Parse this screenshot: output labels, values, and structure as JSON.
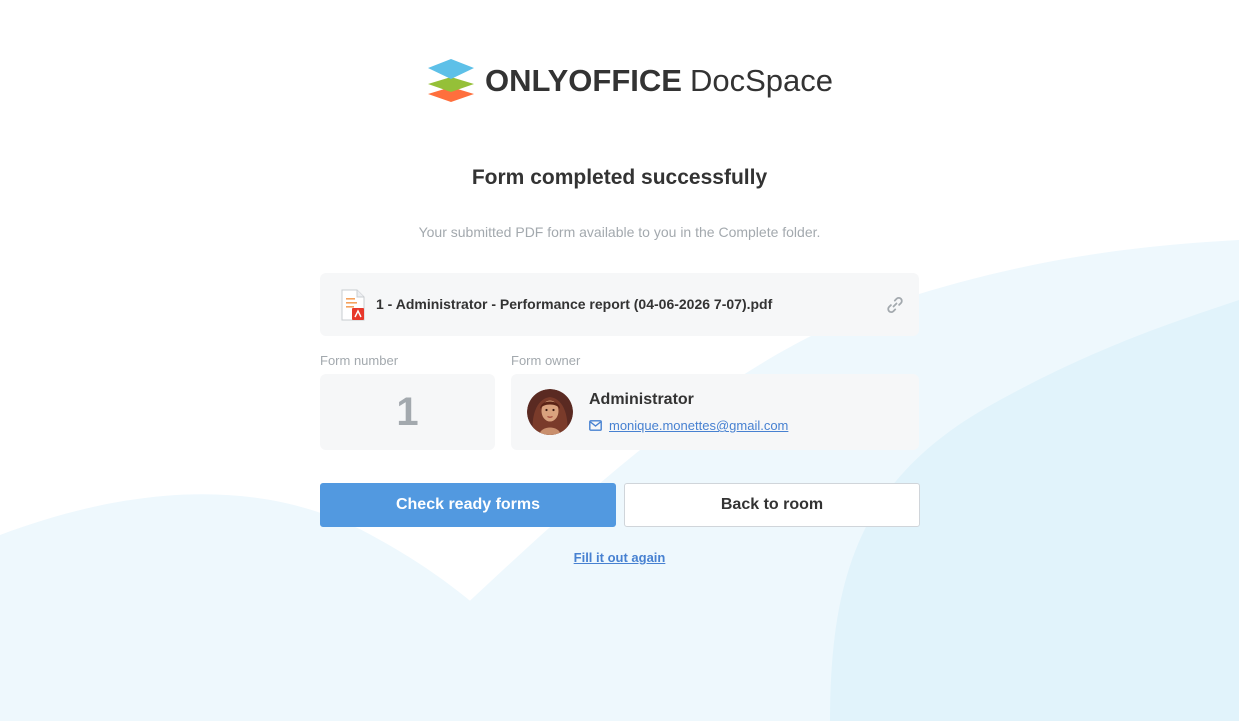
{
  "logo": {
    "brand": "ONLYOFFICE",
    "product": "DocSpace",
    "icon": "onlyoffice-logo-icon"
  },
  "header": {
    "title": "Form completed successfully",
    "subtitle": "Your submitted PDF form available to you in the Complete folder."
  },
  "file": {
    "name": "1 - Administrator - Performance report (04-06-2026 7-07).pdf",
    "file_icon": "pdf-file-icon",
    "link_icon": "link-icon"
  },
  "form_number": {
    "label": "Form number",
    "value": "1"
  },
  "form_owner": {
    "label": "Form owner",
    "name": "Administrator",
    "email": "monique.monettes@gmail.com",
    "mail_icon": "mail-icon"
  },
  "actions": {
    "check_ready_forms": "Check ready forms",
    "back_to_room": "Back to room",
    "fill_again": "Fill it out again"
  },
  "colors": {
    "primary": "#5299e0",
    "link": "#4781d1",
    "muted_text": "#a3a9ae",
    "card_bg": "#f6f7f8",
    "wave_light": "#eef8fd",
    "wave_mid": "#e2f4fb"
  }
}
